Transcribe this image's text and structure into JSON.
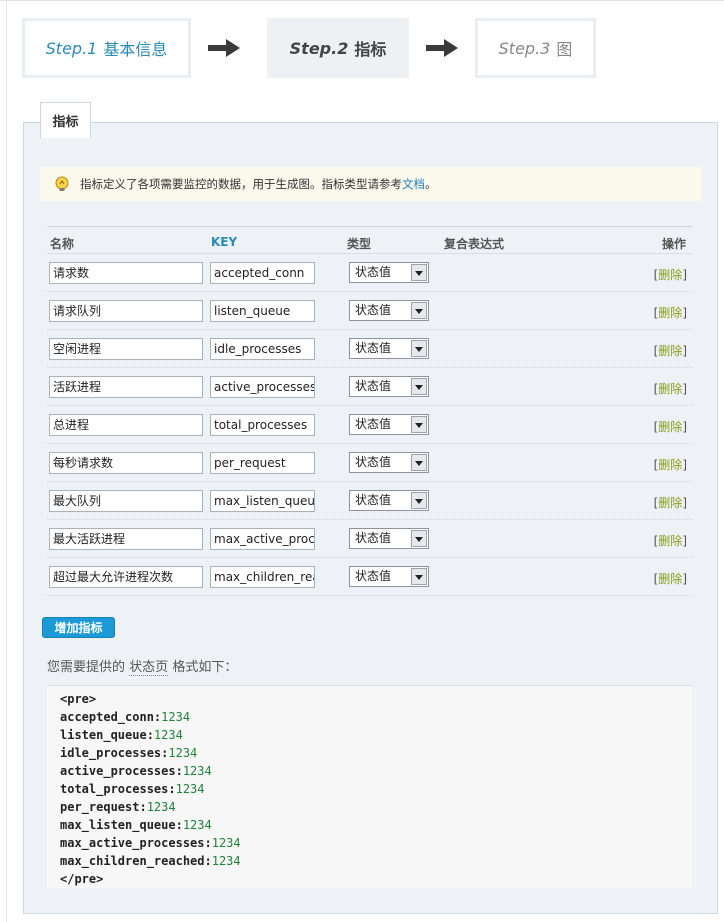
{
  "steps": [
    {
      "no": "Step.1",
      "label": "基本信息",
      "state": "done"
    },
    {
      "no": "Step.2",
      "label": "指标",
      "state": "active"
    },
    {
      "no": "Step.3",
      "label": "图",
      "state": "pending"
    }
  ],
  "panel": {
    "legend": "指标",
    "notice": {
      "text": "指标定义了各项需要监控的数据，用于生成图。指标类型请参考",
      "link": "文档",
      "end": "。"
    }
  },
  "table": {
    "headers": {
      "name": "名称",
      "key": "KEY",
      "type": "类型",
      "expr": "复合表达式",
      "op": "操作"
    },
    "rows": [
      {
        "name": "请求数",
        "key": "accepted_conn",
        "type": "状态值",
        "action": "删除"
      },
      {
        "name": "请求队列",
        "key": "listen_queue",
        "type": "状态值",
        "action": "删除"
      },
      {
        "name": "空闲进程",
        "key": "idle_processes",
        "type": "状态值",
        "action": "删除"
      },
      {
        "name": "活跃进程",
        "key": "active_processes",
        "type": "状态值",
        "action": "删除"
      },
      {
        "name": "总进程",
        "key": "total_processes",
        "type": "状态值",
        "action": "删除"
      },
      {
        "name": "每秒请求数",
        "key": "per_request",
        "type": "状态值",
        "action": "删除"
      },
      {
        "name": "最大队列",
        "key": "max_listen_queue",
        "type": "状态值",
        "action": "删除"
      },
      {
        "name": "最大活跃进程",
        "key": "max_active_processes",
        "type": "状态值",
        "action": "删除"
      },
      {
        "name": "超过最大允许进程次数",
        "key": "max_children_reached",
        "type": "状态值",
        "action": "删除"
      }
    ]
  },
  "add_button": "增加指标",
  "format": {
    "prefix": "您需要提供的",
    "link": "状态页",
    "suffix": "格式如下：",
    "open_tag": "<pre>",
    "close_tag": "</pre>",
    "lines": [
      {
        "key": "accepted_conn:",
        "value": "1234"
      },
      {
        "key": "listen_queue:",
        "value": "1234"
      },
      {
        "key": "idle_processes:",
        "value": "1234"
      },
      {
        "key": "active_processes:",
        "value": "1234"
      },
      {
        "key": "total_processes:",
        "value": "1234"
      },
      {
        "key": "per_request:",
        "value": "1234"
      },
      {
        "key": "max_listen_queue:",
        "value": "1234"
      },
      {
        "key": "max_active_processes:",
        "value": "1234"
      },
      {
        "key": "max_children_reached:",
        "value": "1234"
      }
    ]
  },
  "colors": {
    "accent": "#2a8ab8",
    "button": "#1b9ad6",
    "delete": "#8a9a1c",
    "code_value": "#21803c"
  },
  "icons": {
    "arrow": "arrow-right-icon",
    "notice": "lightbulb-icon",
    "select": "chevron-down-icon"
  }
}
